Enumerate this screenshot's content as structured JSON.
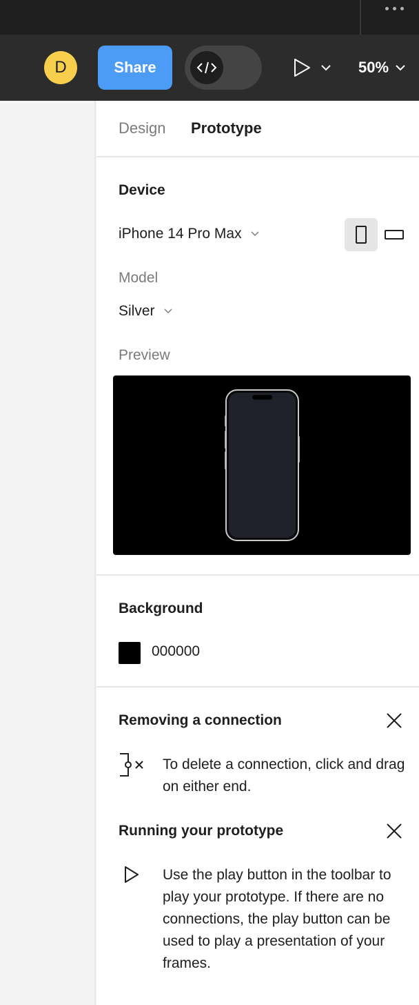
{
  "toolbar": {
    "avatar_initial": "D",
    "share_label": "Share",
    "zoom_label": "50%"
  },
  "panel": {
    "tabs": [
      {
        "label": "Design",
        "active": false
      },
      {
        "label": "Prototype",
        "active": true
      }
    ],
    "device": {
      "section_title": "Device",
      "selected_device": "iPhone 14 Pro Max",
      "model_label": "Model",
      "selected_model": "Silver",
      "preview_label": "Preview",
      "orientation": "portrait"
    },
    "background": {
      "section_title": "Background",
      "color_hex": "000000",
      "color": "#000000"
    },
    "tips": [
      {
        "title": "Removing a connection",
        "text": "To delete a connection, click and drag on either end.",
        "icon": "remove-connection-icon"
      },
      {
        "title": "Running your prototype",
        "text": "Use the play button in the toolbar to play your prototype. If there are no connections, the play button can be used to play a presentation of your frames.",
        "icon": "play-icon"
      }
    ]
  },
  "colors": {
    "accent": "#4c9cf6",
    "avatar": "#f7cf4c",
    "toolbar_bg": "#2c2c2c",
    "titlebar_bg": "#1e1e1e"
  }
}
